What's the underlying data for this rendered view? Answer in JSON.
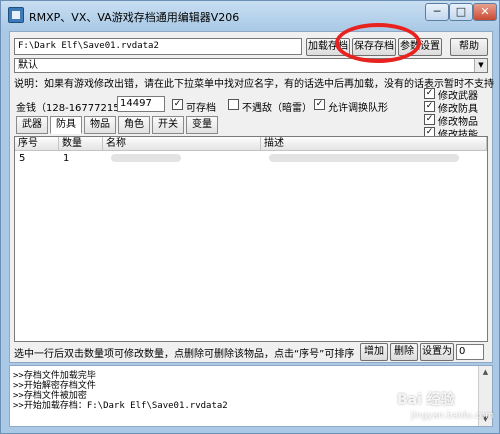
{
  "window": {
    "title": "RMXP、VX、VA游戏存档通用编辑器V206",
    "min_label": "─",
    "max_label": "□",
    "close_label": "✕"
  },
  "toolbar": {
    "path": "F:\\Dark Elf\\Save01.rvdata2",
    "load_label": "加载存档",
    "save_label": "保存存档",
    "params_label": "参数设置",
    "help_label": "帮助"
  },
  "preset": {
    "selected": "默认",
    "arrow": "▼"
  },
  "note": "说明：如果有游戏修改出错，请在此下拉菜单中找对应名字，有的话选中后再加载，没有的话表示暂时不支持",
  "money": {
    "label": "金钱（128-16777215）",
    "value": "14497"
  },
  "options": [
    {
      "label": "可存档",
      "checked": true
    },
    {
      "label": "不遇敌（暗雷）",
      "checked": false
    },
    {
      "label": "允许调换队形",
      "checked": true
    }
  ],
  "modify_checks": [
    {
      "label": "修改武器",
      "checked": true
    },
    {
      "label": "修改防具",
      "checked": true
    },
    {
      "label": "修改物品",
      "checked": true
    },
    {
      "label": "修改技能",
      "checked": true
    }
  ],
  "tabs": [
    "武器",
    "防具",
    "物品",
    "角色",
    "开关",
    "变量"
  ],
  "active_tab": "防具",
  "table": {
    "headers": [
      "序号",
      "数量",
      "名称",
      "描述"
    ],
    "rows": [
      {
        "index": "5",
        "qty": "1"
      }
    ]
  },
  "bottom": {
    "hint": "选中一行后双击数量项可修改数量，点删除可删除该物品，点击“序号”可排序",
    "add_label": "增加",
    "delete_label": "删除",
    "set_label": "设置为",
    "set_value": "0"
  },
  "log": [
    ">>存档文件加载完毕",
    ">>开始解密存档文件",
    ">>存档文件被加密",
    ">>开始加载存档：F:\\Dark Elf\\Save01.rvdata2"
  ],
  "scroll": {
    "up": "▲",
    "down": "▼"
  },
  "watermark": {
    "main": "Bai 经验",
    "sub": "jingyan.baidu.com"
  },
  "colors": {
    "annotation": "#e8231f",
    "titlebar": "#a9c9e6"
  }
}
